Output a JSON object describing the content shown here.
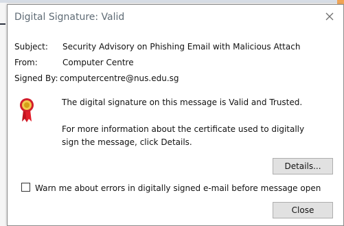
{
  "dialog": {
    "title": "Digital Signature: Valid",
    "fields": {
      "subject_label": "Subject:",
      "subject_value": "Security Advisory on Phishing Email with Malicious Attach",
      "from_label": "From:",
      "from_value": "Computer Centre",
      "signed_by_label": "Signed By:",
      "signed_by_value": "computercentre@nus.edu.sg"
    },
    "message": {
      "line1": "The digital signature on this message is Valid and Trusted.",
      "line2": "For more information about the certificate used to digitally",
      "line3": "sign the message, click Details."
    },
    "buttons": {
      "details": "Details...",
      "close": "Close"
    },
    "checkbox": {
      "label": "Warn me about errors in digitally signed e-mail before message open",
      "checked": false
    },
    "icons": {
      "close": "close-icon",
      "signature": "signature-seal-icon"
    }
  }
}
